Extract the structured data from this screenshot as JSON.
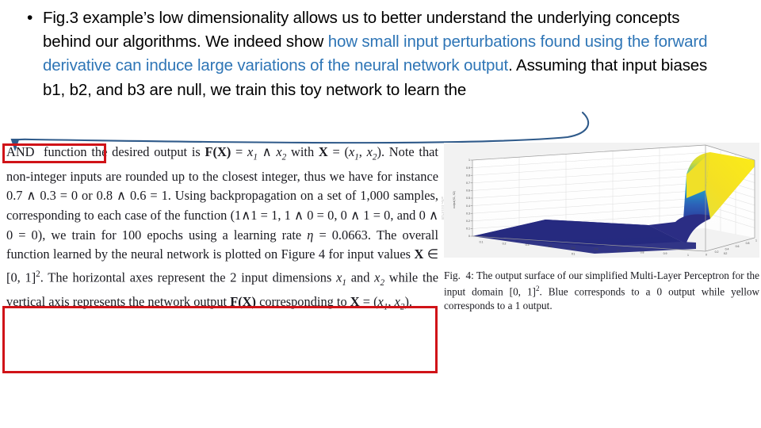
{
  "slide": {
    "bullet_marker": "•",
    "paragraph_segments": [
      {
        "text": "Fig.3 example’s low dimensionality allows us to better understand the underlying concepts behind our algorithms. We indeed show ",
        "highlight": false
      },
      {
        "text": "how small input perturbations found using the forward derivative can induce large variations of the neural network output",
        "highlight": true
      },
      {
        "text": ". Assuming that input biases b1, b2, and b3 are null, we train this toy network to learn the",
        "highlight": false
      }
    ],
    "full_text": "Fig.3 example’s low dimensionality allows us to better understand the underlying concepts behind our algorithms. We indeed show how small input perturbations found using the forward derivative can induce large variations of the neural network output. Assuming that input biases b1, b2, and b3 are null, we train this toy network to learn the",
    "highlight_color": "#2E75B6",
    "body_color": "#000000"
  },
  "annotations": {
    "arrow_color": "#2F5A8A",
    "arrow_label": "curved-arrow-to-and-function",
    "red_box_color": "#D01318",
    "boxes": [
      {
        "name": "and-function-highlight",
        "target": "AND function"
      },
      {
        "name": "axes-description-highlight",
        "target": "values X in [0,1]^2 ... network output F(X) corresponding to X = (x1, x2)."
      }
    ]
  },
  "paper": {
    "body_lines": [
      "AND function the desired output is F(X) = x1 ∧ x2 with",
      "X = (x1, x2). Note that non-integer inputs are rounded up to",
      "the closest integer, thus we have for instance 0.7 ∧ 0.3 = 0",
      "or 0.8 ∧ 0.6 = 1. Using backpropagation on a set of 1,000",
      "samples, corresponding to each case of the function (1∧1 = 1,",
      "1 ∧ 0 = 0, 0 ∧ 1 = 0, and 0 ∧ 0 = 0), we train for 100",
      "epochs using a learning rate η = 0.0663. The overall function",
      "learned by the neural network is plotted on Figure 4 for input",
      "values X ∈ [0, 1]². The horizontal axes represent the 2 input",
      "dimensions x1 and x2 while the vertical axis represents the",
      "network output F(X) corresponding to X = (x1, x2)."
    ],
    "boxed_term": "AND function",
    "learning_rate": "0.0663",
    "epochs": "100",
    "samples": "1,000"
  },
  "figure": {
    "caption_number": "Fig. 4:",
    "caption_text": "Fig. 4: The output surface of our simplified Multi-Layer Perceptron for the input domain [0, 1]². Blue corresponds to a 0 output while yellow corresponds to a 1 output."
  },
  "chart_data": {
    "type": "surface",
    "title": "",
    "xlabel": "X1",
    "ylabel": "X2",
    "zlabel": "output(X1, X2)",
    "xlim": [
      0,
      1
    ],
    "ylim": [
      0,
      1
    ],
    "zlim": [
      0,
      1
    ],
    "xticks": [
      "0.1",
      "0.2",
      "0.3",
      "0.4",
      "0.5",
      "0.6",
      "0.7",
      "0.8",
      "0.9",
      "1"
    ],
    "yticks": [
      "0",
      "0.2",
      "0.4",
      "0.6",
      "0.8",
      "1"
    ],
    "zticks": [
      "0",
      "0.1",
      "0.2",
      "0.3",
      "0.4",
      "0.5",
      "0.6",
      "0.7",
      "0.8",
      "0.9",
      "1"
    ],
    "grid": true,
    "legend": "none",
    "colormap": "parula",
    "colormap_low": "#2B2B8F",
    "colormap_mid": "#2196C4",
    "colormap_high": "#F6E21C",
    "description": "Output surface of an MLP learning the AND function: near 0 (dark blue) over most of the [0,1]^2 domain, rising sharply to 1 (yellow) in the corner where both x1 and x2 approach 1.",
    "surface_samples": [
      {
        "x1": 0.0,
        "x2": 0.0,
        "z": 0.0
      },
      {
        "x1": 0.5,
        "x2": 0.0,
        "z": 0.0
      },
      {
        "x1": 1.0,
        "x2": 0.0,
        "z": 0.01
      },
      {
        "x1": 0.0,
        "x2": 0.5,
        "z": 0.0
      },
      {
        "x1": 0.5,
        "x2": 0.5,
        "z": 0.02
      },
      {
        "x1": 1.0,
        "x2": 0.5,
        "z": 0.1
      },
      {
        "x1": 0.0,
        "x2": 1.0,
        "z": 0.01
      },
      {
        "x1": 0.5,
        "x2": 1.0,
        "z": 0.12
      },
      {
        "x1": 0.8,
        "x2": 0.8,
        "z": 0.45
      },
      {
        "x1": 0.9,
        "x2": 0.9,
        "z": 0.92
      },
      {
        "x1": 1.0,
        "x2": 1.0,
        "z": 1.0
      }
    ]
  }
}
